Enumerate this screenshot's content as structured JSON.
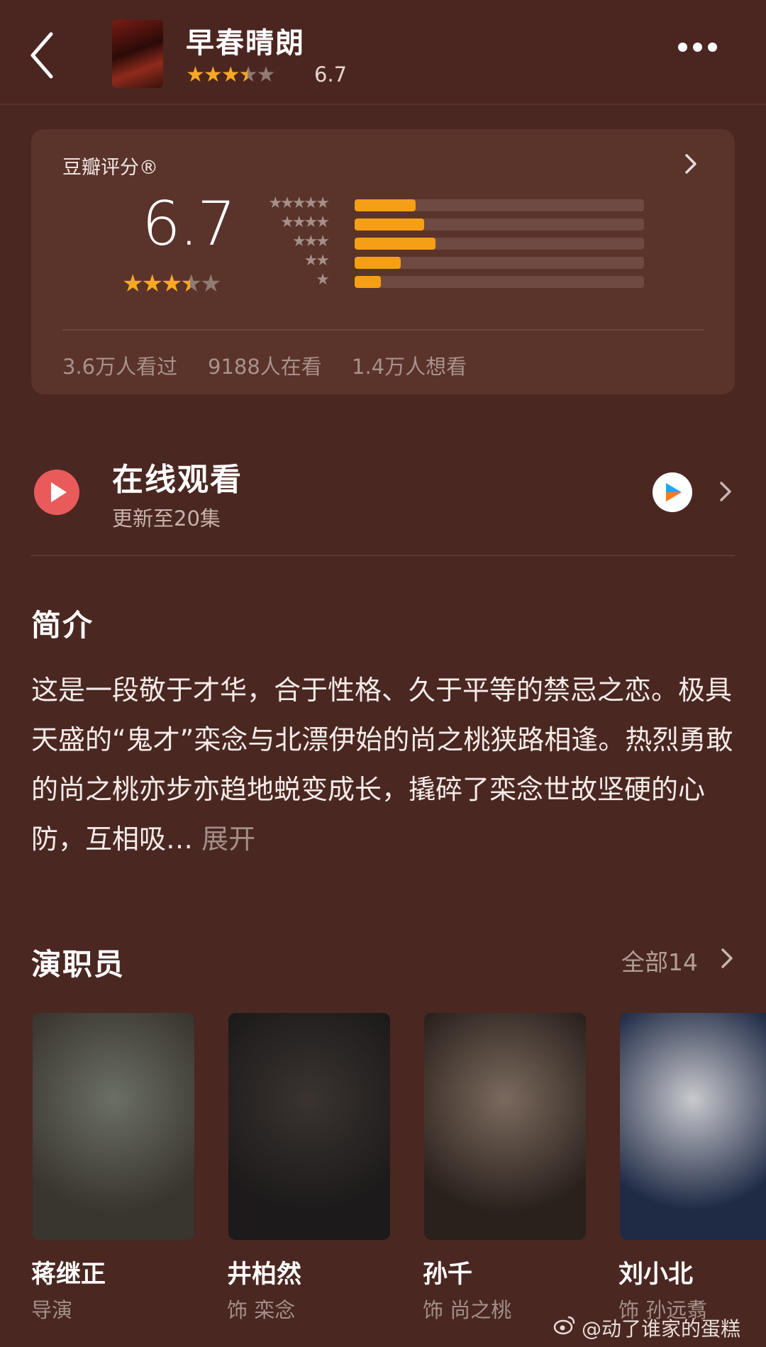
{
  "header": {
    "title": "早春晴朗",
    "score": "6.7",
    "stars": {
      "full": 3,
      "half": 1,
      "empty": 1
    }
  },
  "rating": {
    "label": "豆瓣评分®",
    "score": "6.7",
    "stars": {
      "full": 3,
      "half": 1,
      "empty": 1
    },
    "distribution": [
      {
        "stars": 5,
        "fraction": 0.21
      },
      {
        "stars": 4,
        "fraction": 0.24
      },
      {
        "stars": 3,
        "fraction": 0.28
      },
      {
        "stars": 2,
        "fraction": 0.16
      },
      {
        "stars": 1,
        "fraction": 0.09
      }
    ],
    "stats": [
      "3.6万人看过",
      "9188人在看",
      "1.4万人想看"
    ]
  },
  "watch": {
    "title": "在线观看",
    "subtitle": "更新至20集"
  },
  "synopsis": {
    "title": "简介",
    "text": "这是一段敬于才华，合于性格、久于平等的禁忌之恋。极具天盛的“鬼才”栾念与北漂伊始的尚之桃狭路相逢。热烈勇敢的尚之桃亦步亦趋地蜕变成长，撬碎了栾念世故坚硬的心防，互相吸…",
    "expand": "展开"
  },
  "cast": {
    "title": "演职员",
    "all": "全部14",
    "members": [
      {
        "name": "蒋继正",
        "role": "导演",
        "colors": [
          "#6b6f64",
          "#39352f"
        ]
      },
      {
        "name": "井柏然",
        "role": "饰 栾念",
        "colors": [
          "#3a3330",
          "#1c1a1a"
        ]
      },
      {
        "name": "孙千",
        "role": "饰 尚之桃",
        "colors": [
          "#7b6a5e",
          "#2a211d"
        ]
      },
      {
        "name": "刘小北",
        "role": "饰 孙远翥",
        "colors": [
          "#c9c9cd",
          "#1f2a45"
        ]
      }
    ]
  },
  "watermark": "@动了谁家的蛋糕"
}
